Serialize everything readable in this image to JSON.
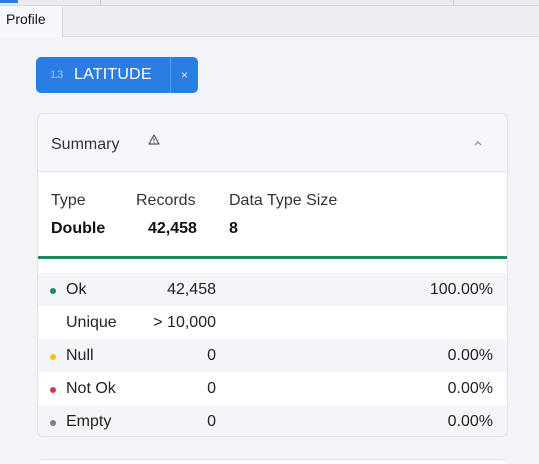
{
  "tabs": [
    {
      "label": "Profile"
    }
  ],
  "field_chip": {
    "type_icon": "1.3",
    "label": "LATITUDE",
    "close": "×"
  },
  "summary": {
    "title": "Summary",
    "meta": {
      "type_header": "Type",
      "type_value": "Double",
      "records_header": "Records",
      "records_value": "42,458",
      "size_header": "Data Type Size",
      "size_value": "8"
    },
    "rows": [
      {
        "label": "Ok",
        "count": "42,458",
        "percent": "100.00%",
        "dot_color": "#1f8a5a"
      },
      {
        "label": "Unique",
        "count": "> 10,000",
        "percent": ""
      },
      {
        "label": "Null",
        "count": "0",
        "percent": "0.00%",
        "dot_color": "#f2c21b"
      },
      {
        "label": "Not Ok",
        "count": "0",
        "percent": "0.00%",
        "dot_color": "#d83a4a"
      },
      {
        "label": "Empty",
        "count": "0",
        "percent": "0.00%",
        "dot_color": "#7f7f7f"
      }
    ]
  },
  "colors": {
    "accent": "#2a7ee3",
    "ok_rule": "#1f8a5a"
  },
  "icons": {
    "warning": "warning-triangle-icon",
    "collapse": "chevron-up-icon",
    "close": "close-icon",
    "type": "decimal-type-icon"
  }
}
